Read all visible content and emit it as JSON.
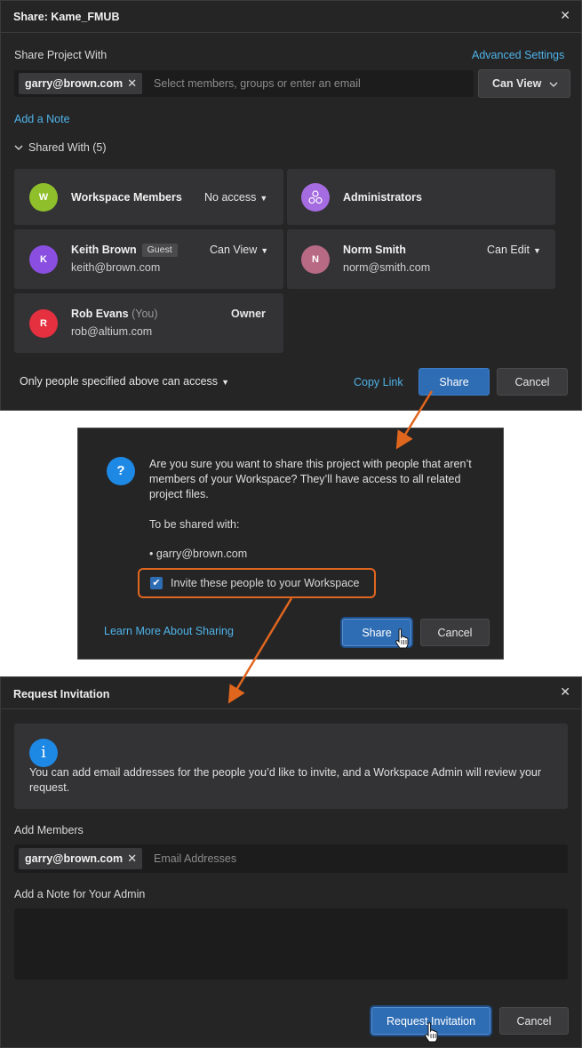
{
  "share_dialog": {
    "title": "Share: Kame_FMUB",
    "share_with_label": "Share Project With",
    "advanced_settings": "Advanced Settings",
    "chip_email": "garry@brown.com",
    "chip_close": "✕",
    "input_placeholder": "Select members, groups or enter an email",
    "permission_select": "Can View",
    "add_note": "Add a Note",
    "shared_with_header": "Shared With (5)",
    "members": [
      {
        "initial": "W",
        "name": "Workspace Members",
        "permission": "No access",
        "color": "#8fbf2a"
      },
      {
        "initial": "",
        "name": "Administrators",
        "permission": "",
        "color": "#a56be0"
      },
      {
        "initial": "K",
        "name": "Keith Brown",
        "tag": "Guest",
        "email": "keith@brown.com",
        "permission": "Can View",
        "color": "#8a4fe0"
      },
      {
        "initial": "N",
        "name": "Norm Smith",
        "email": "norm@smith.com",
        "permission": "Can Edit",
        "color": "#b86a84"
      },
      {
        "initial": "R",
        "name": "Rob Evans",
        "suffix": "(You)",
        "email": "rob@altium.com",
        "permission": "Owner",
        "color": "#e53040"
      }
    ],
    "access_dropdown": "Only people specified above can access",
    "copy_link": "Copy Link",
    "share_button": "Share",
    "cancel_button": "Cancel"
  },
  "confirm_dialog": {
    "question_icon": "?",
    "message": "Are you sure you want to share this project with people that aren’t members of your Workspace? They’ll have access to all related project files.",
    "shared_with_label": "To be shared with:",
    "recipient": "• garry@brown.com",
    "invite_checkbox_label": "Invite these people to your Workspace",
    "invite_checked": true,
    "learn_more": "Learn More About Sharing",
    "share_button": "Share",
    "cancel_button": "Cancel"
  },
  "request_dialog": {
    "title": "Request Invitation",
    "info_icon": "i",
    "info_text": "You can add email addresses for the people you’d like to invite, and a Workspace Admin will review your request.",
    "add_members_label": "Add Members",
    "chip_email": "garry@brown.com",
    "chip_close": "✕",
    "email_placeholder": "Email Addresses",
    "note_label": "Add a Note for Your Admin",
    "request_button": "Request Invitation",
    "cancel_button": "Cancel"
  },
  "colors": {
    "accent": "#2e6db4",
    "link": "#4fb3e8",
    "annotation": "#e0661e",
    "dialog_bg": "#252526"
  },
  "icons": [
    "close-icon",
    "chevron-down-icon",
    "group-icon",
    "question-icon",
    "info-icon",
    "checkmark-icon",
    "hand-cursor-icon",
    "arrow-annotation"
  ]
}
